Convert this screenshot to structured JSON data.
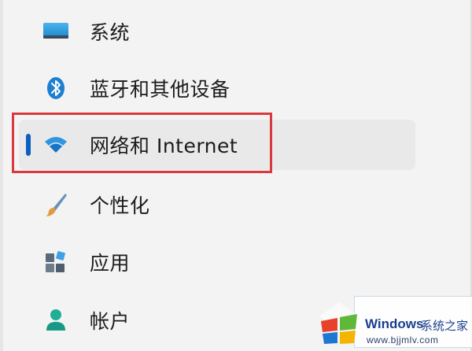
{
  "nav": {
    "items": [
      {
        "label": "系统",
        "icon": "monitor-icon",
        "selected": false
      },
      {
        "label": "蓝牙和其他设备",
        "icon": "bluetooth-icon",
        "selected": false
      },
      {
        "label": "网络和 Internet",
        "icon": "wifi-icon",
        "selected": true
      },
      {
        "label": "个性化",
        "icon": "brush-icon",
        "selected": false
      },
      {
        "label": "应用",
        "icon": "apps-icon",
        "selected": false
      },
      {
        "label": "帐户",
        "icon": "person-icon",
        "selected": false
      }
    ]
  },
  "colors": {
    "background": "#f3f3f3",
    "selected_background": "#e9e9e9",
    "accent": "#0a5fc0",
    "highlight_border": "#d9383f"
  },
  "watermark": {
    "brand": "Windows",
    "brand_cn": "系统之家",
    "url": "www.bjjmlv.com"
  }
}
